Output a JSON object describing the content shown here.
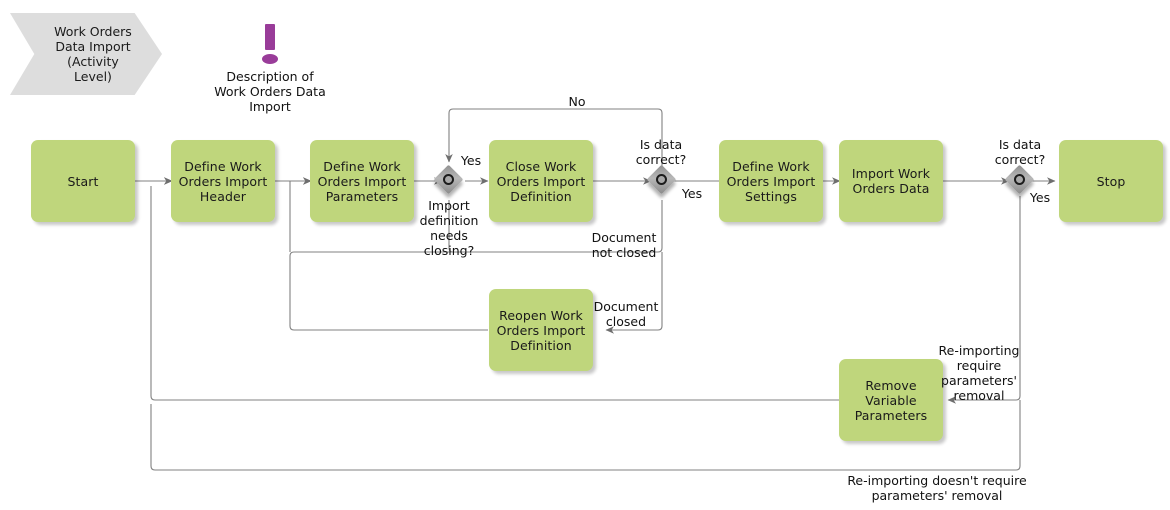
{
  "diagram": {
    "title": "Work Orders Data Import (Activity Level)",
    "type": "bpmn-flowchart",
    "colors": {
      "activity_fill": "#BFD67C",
      "pool_fill": "#DDDDDD",
      "gateway_fill": "#A0A0A0",
      "note_marker": "#993C99",
      "connector": "#808080",
      "text": "#111111"
    }
  },
  "pool": {
    "label": "Work Orders\nData Import\n(Activity\nLevel)"
  },
  "note": {
    "marker": "exclamation-marker",
    "label": "Description of\nWork Orders Data\nImport"
  },
  "nodes": [
    {
      "id": "start",
      "label": "Start"
    },
    {
      "id": "define_header",
      "label": "Define Work\nOrders Import\nHeader"
    },
    {
      "id": "define_params",
      "label": "Define Work\nOrders Import\nParameters"
    },
    {
      "id": "close_def",
      "label": "Close Work\nOrders Import\nDefinition"
    },
    {
      "id": "define_set",
      "label": "Define Work\nOrders Import\nSettings"
    },
    {
      "id": "import_data",
      "label": "Import Work\nOrders Data"
    },
    {
      "id": "stop",
      "label": "Stop"
    },
    {
      "id": "reopen_def",
      "label": "Reopen Work\nOrders Import\nDefinition"
    },
    {
      "id": "remove_params",
      "label": "Remove\nVariable\nParameters"
    }
  ],
  "gateways": [
    {
      "id": "gw_closing",
      "question": "Import\ndefinition\nneeds\nclosing?"
    },
    {
      "id": "gw_correct1",
      "question": "Is data\ncorrect?"
    },
    {
      "id": "gw_correct2",
      "question": "Is data\ncorrect?"
    }
  ],
  "edge_labels": {
    "yes_closing": "Yes",
    "no_top": "No",
    "yes_correct1": "Yes",
    "yes_correct2": "Yes",
    "document_not_closed": "Document\nnot closed",
    "document_closed": "Document\nclosed",
    "reimport_require": "Re-importing\nrequire\nparameters'\nremoval",
    "reimport_not_require": "Re-importing doesn't require\nparameters' removal"
  }
}
